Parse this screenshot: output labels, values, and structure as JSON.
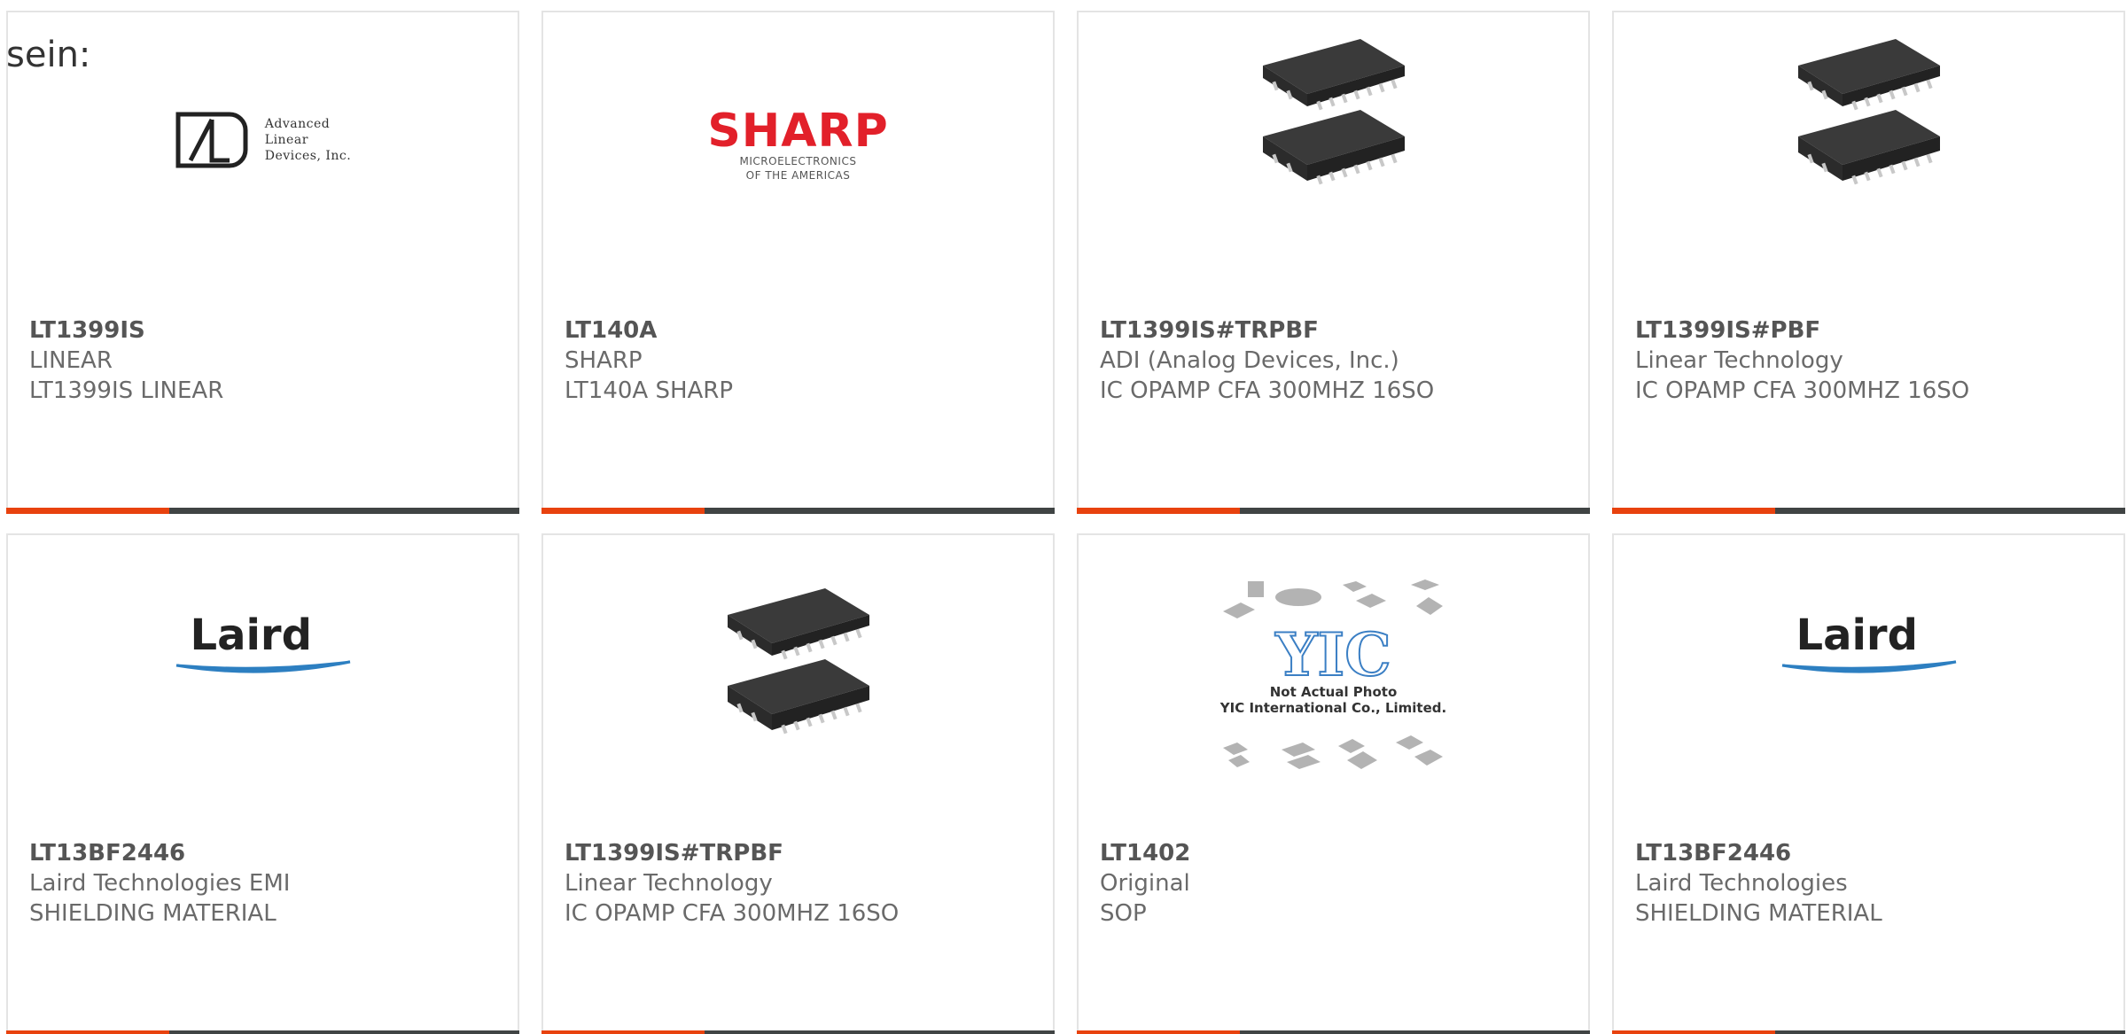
{
  "intro_text": "sein:",
  "colors": {
    "accent_bar": "#e8420e",
    "bar": "#404444",
    "card_border": "#e4e4e4"
  },
  "logos": {
    "ald": [
      "Advanced",
      "Linear",
      "Devices, Inc."
    ],
    "sharp_word": "SHARP",
    "sharp_sub": [
      "MICROELECTRONICS",
      "OF THE AMERICAS"
    ],
    "laird_word": "Laird",
    "yic_mark": "YIC",
    "yic_caption": [
      "Not Actual Photo",
      "YIC International Co., Limited."
    ]
  },
  "products": [
    {
      "part": "LT1399IS",
      "line1": "LINEAR",
      "line2": "LT1399IS LINEAR",
      "image": "ald-logo"
    },
    {
      "part": "LT140A",
      "line1": "SHARP",
      "line2": "LT140A SHARP",
      "image": "sharp-logo"
    },
    {
      "part": "LT1399IS#TRPBF",
      "line1": "ADI (Analog Devices, Inc.)",
      "line2": "IC OPAMP CFA 300MHZ 16SO",
      "image": "ic-chip"
    },
    {
      "part": "LT1399IS#PBF",
      "line1": "Linear Technology",
      "line2": "IC OPAMP CFA 300MHZ 16SO",
      "image": "ic-chip"
    },
    {
      "part": "LT13BF2446",
      "line1": "Laird Technologies EMI",
      "line2": "SHIELDING MATERIAL",
      "image": "laird-logo"
    },
    {
      "part": "LT1399IS#TRPBF",
      "line1": "Linear Technology",
      "line2": "IC OPAMP CFA 300MHZ 16SO",
      "image": "ic-chip"
    },
    {
      "part": "LT1402",
      "line1": "Original",
      "line2": "SOP",
      "image": "yic-placeholder"
    },
    {
      "part": "LT13BF2446",
      "line1": "Laird Technologies",
      "line2": "SHIELDING MATERIAL",
      "image": "laird-logo"
    }
  ]
}
